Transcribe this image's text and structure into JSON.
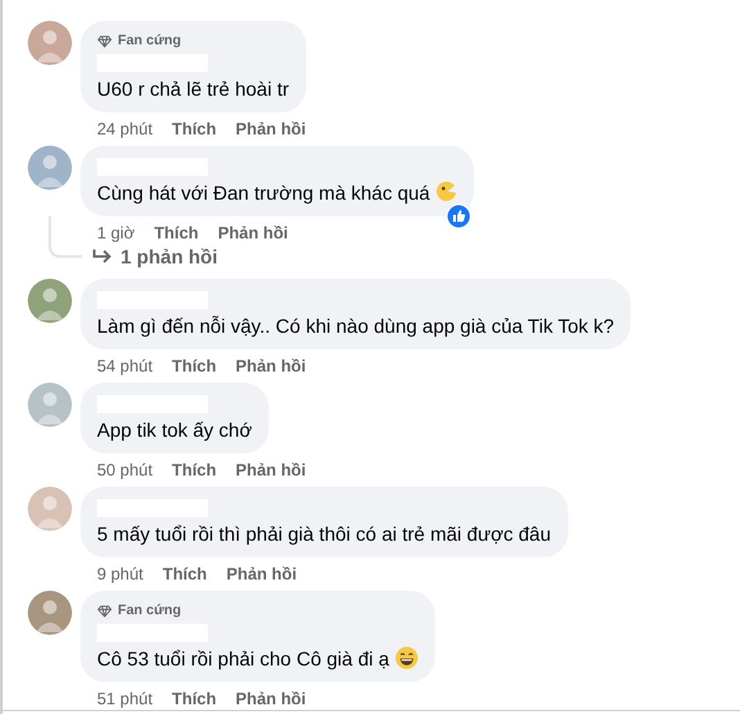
{
  "comments": [
    {
      "badge": "Fan cứng",
      "text": "U60 r chả lẽ trẻ hoài tr",
      "kind": "plain",
      "liked": false,
      "time": "24 phút",
      "like": "Thích",
      "reply": "Phản hồi"
    },
    {
      "text": "Cùng hát với Đan trường mà khác quá",
      "kind": "tongue",
      "liked": true,
      "time": "1 giờ",
      "like": "Thích",
      "reply": "Phản hồi",
      "replies": "1 phản hồi"
    },
    {
      "text": "Làm gì đến nỗi vậy.. Có khi nào dùng app già của Tik Tok k?",
      "kind": "plain",
      "liked": false,
      "time": "54 phút",
      "like": "Thích",
      "reply": "Phản hồi"
    },
    {
      "text": "App tik tok ấy chớ",
      "kind": "plain",
      "liked": false,
      "time": "50 phút",
      "like": "Thích",
      "reply": "Phản hồi"
    },
    {
      "text": "5 mấy tuổi rồi thì phải già thôi có ai trẻ mãi được đâu",
      "kind": "plain",
      "liked": false,
      "time": "9 phút",
      "like": "Thích",
      "reply": "Phản hồi"
    },
    {
      "badge": "Fan cứng",
      "text": "Cô 53 tuổi rồi phải cho Cô già đi ạ",
      "kind": "grin",
      "liked": false,
      "time": "51 phút",
      "like": "Thích",
      "reply": "Phản hồi"
    }
  ]
}
